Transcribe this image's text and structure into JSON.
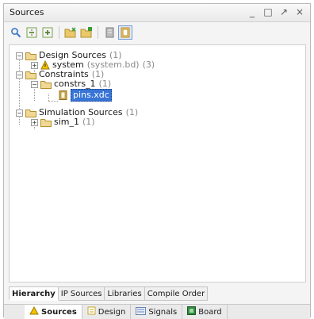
{
  "window": {
    "title": "Sources"
  },
  "tree": {
    "design_sources": {
      "label": "Design Sources",
      "count": "(1)"
    },
    "system": {
      "label": "system",
      "file": "(system.bd)",
      "count": "(3)"
    },
    "constraints": {
      "label": "Constraints",
      "count": "(1)"
    },
    "constrs_1": {
      "label": "constrs_1",
      "count": "(1)"
    },
    "pins_xdc": {
      "label": "pins.xdc"
    },
    "simulation_sources": {
      "label": "Simulation Sources",
      "count": "(1)"
    },
    "sim_1": {
      "label": "sim_1",
      "count": "(1)"
    }
  },
  "bottom_tabs": [
    {
      "label": "Hierarchy"
    },
    {
      "label": "IP Sources"
    },
    {
      "label": "Libraries"
    },
    {
      "label": "Compile Order"
    }
  ],
  "view_tabs": [
    {
      "label": "Sources",
      "icon": "sources-icon"
    },
    {
      "label": "Design",
      "icon": "design-icon"
    },
    {
      "label": "Signals",
      "icon": "signals-icon"
    },
    {
      "label": "Board",
      "icon": "board-icon"
    }
  ],
  "colors": {
    "folder": "#e9c96a",
    "selection": "#3875d7",
    "warning": "#f2c200"
  }
}
